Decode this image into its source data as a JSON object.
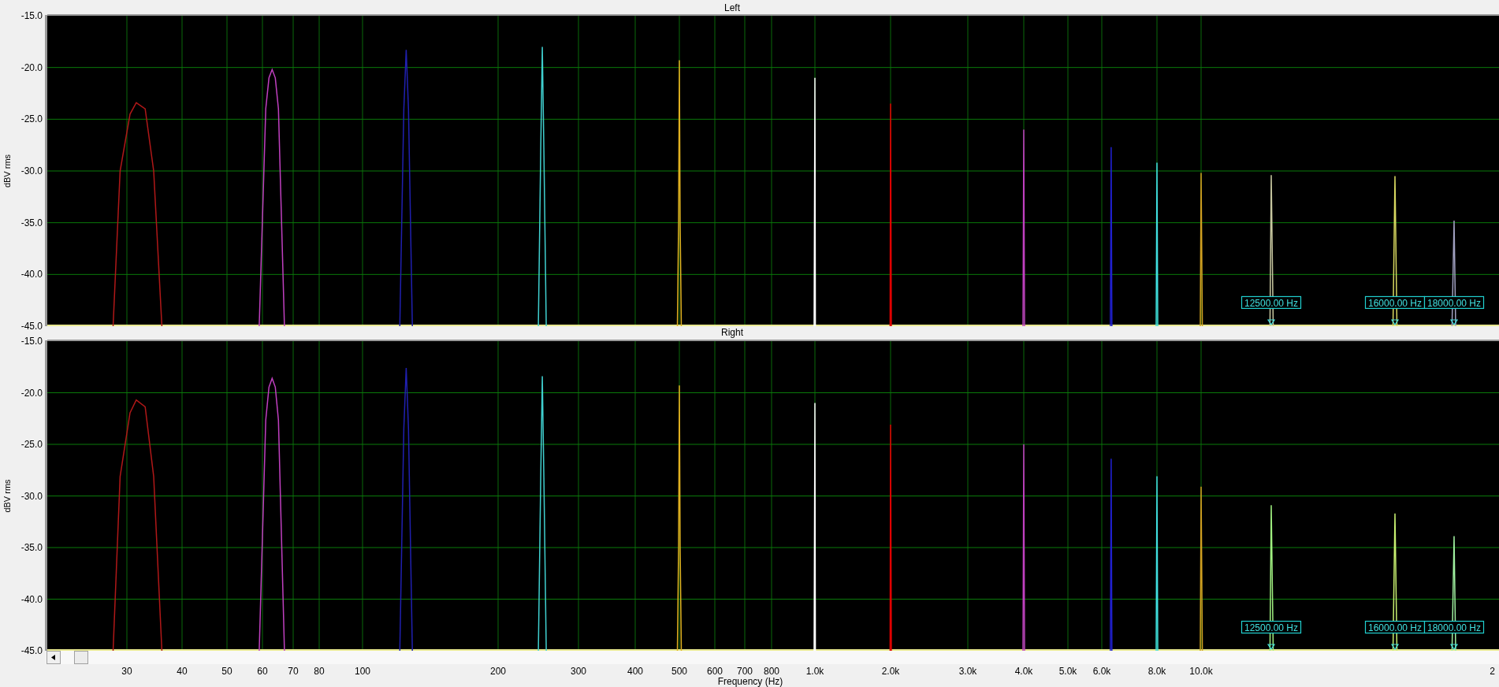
{
  "panels": [
    {
      "title": "Left",
      "y_axis_title": "dBV rms",
      "y_tick_labels": [
        "-15.0",
        "-20.0",
        "-25.0",
        "-30.0",
        "-35.0",
        "-40.0",
        "-45.0"
      ],
      "marker_labels": [
        "12500.00 Hz",
        "16000.00 Hz",
        "18000.00 Hz"
      ]
    },
    {
      "title": "Right",
      "y_axis_title": "dBV rms",
      "y_tick_labels": [
        "-15.0",
        "-20.0",
        "-25.0",
        "-30.0",
        "-35.0",
        "-40.0",
        "-45.0"
      ],
      "marker_labels": [
        "12500.00 Hz",
        "16000.00 Hz",
        "18000.00 Hz"
      ],
      "x_tick_labels": [
        "30",
        "40",
        "50",
        "60",
        "70",
        "80",
        "100",
        "200",
        "300",
        "400",
        "500",
        "600",
        "700",
        "800",
        "1.0k",
        "2.0k",
        "3.0k",
        "4.0k",
        "5.0k",
        "6.0k",
        "8.0k",
        "10.0k",
        "2"
      ],
      "x_axis_title": "Frequency (Hz)"
    }
  ]
}
